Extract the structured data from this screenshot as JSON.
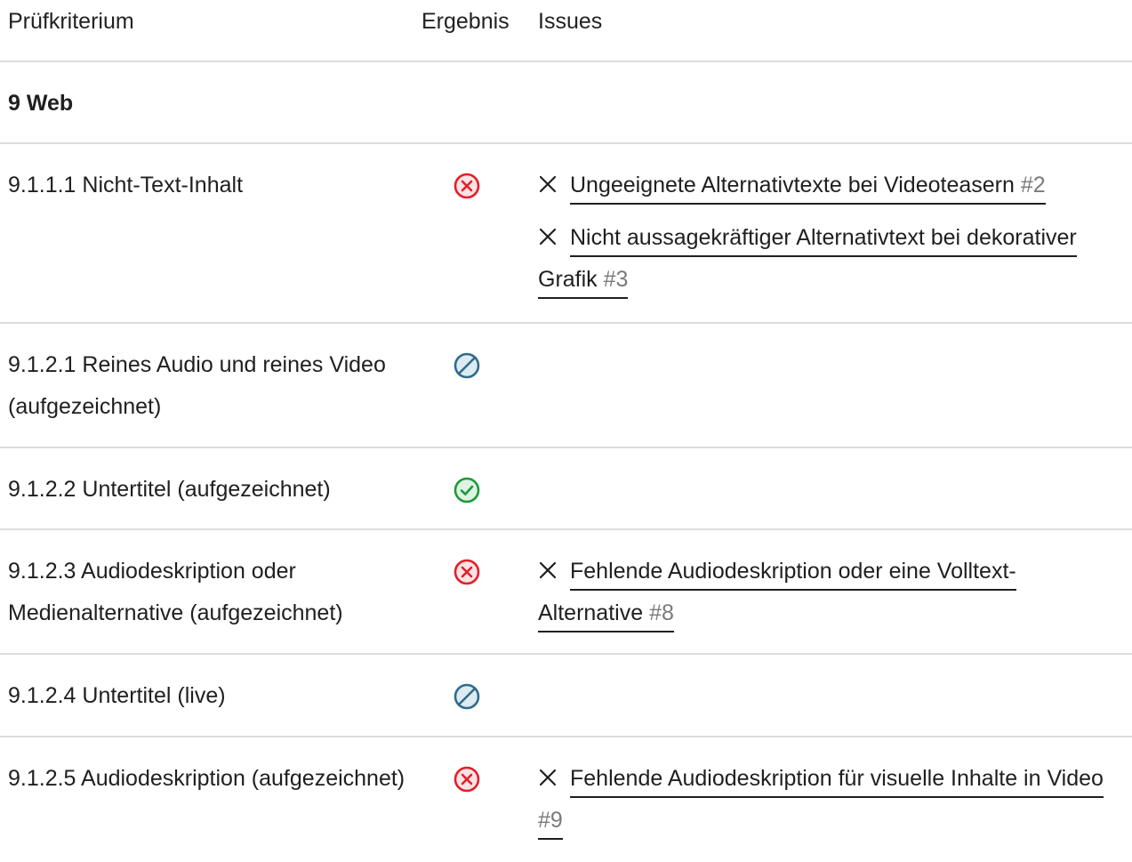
{
  "header": {
    "col_criterion": "Prüfkriterium",
    "col_result": "Ergebnis",
    "col_issues": "Issues"
  },
  "section": {
    "title": "9 Web"
  },
  "colors": {
    "fail": "#e0202a",
    "fail_bg": "#fbe3e4",
    "na": "#2f6c8a",
    "na_bg": "#dcebf2",
    "pass": "#1c9a3a",
    "pass_bg": "#dff3e4"
  },
  "rows": [
    {
      "criterion": "9.1.1.1 Nicht-Text-Inhalt",
      "result": "fail",
      "result_icon": "x-circle-icon",
      "issues": [
        {
          "title": "Ungeeignete Alternativtexte bei Videoteasern",
          "number": "#2"
        },
        {
          "title": "Nicht aussagekräftiger Alternativtext bei dekorativer Grafik",
          "number": "#3"
        }
      ]
    },
    {
      "criterion": "9.1.2.1 Reines Audio und reines Video (aufgezeichnet)",
      "result": "not-applicable",
      "result_icon": "ban-icon",
      "issues": []
    },
    {
      "criterion": "9.1.2.2 Untertitel (aufgezeichnet)",
      "result": "pass",
      "result_icon": "check-circle-icon",
      "issues": []
    },
    {
      "criterion": "9.1.2.3 Audiodeskription oder Medienalternative (aufgezeichnet)",
      "result": "fail",
      "result_icon": "x-circle-icon",
      "issues": [
        {
          "title": "Fehlende Audiodeskription oder eine Volltext-Alternative",
          "number": "#8"
        }
      ]
    },
    {
      "criterion": "9.1.2.4 Untertitel (live)",
      "result": "not-applicable",
      "result_icon": "ban-icon",
      "issues": []
    },
    {
      "criterion": "9.1.2.5 Audiodeskription (aufgezeichnet)",
      "result": "fail",
      "result_icon": "x-circle-icon",
      "issues": [
        {
          "title": "Fehlende Audiodeskription für visuelle Inhalte in Video",
          "number": "#9"
        }
      ]
    }
  ]
}
